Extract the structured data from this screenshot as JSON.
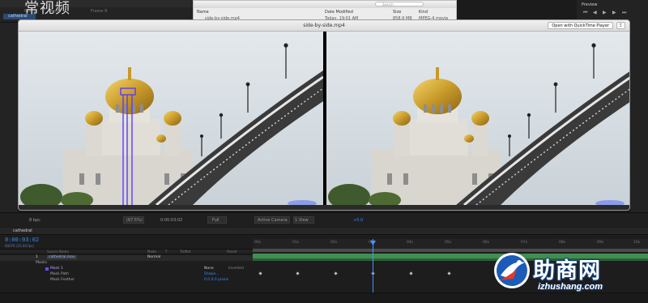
{
  "watermark_top": {
    "text": "常视频"
  },
  "project": {
    "columns": [
      "Name",
      "Type",
      "Frame R"
    ],
    "item": "cathedral"
  },
  "finder": {
    "columns": {
      "name": "Name",
      "date_modified": "Date Modified",
      "size": "Size",
      "kind": "Kind"
    },
    "row": {
      "name": "side-by-side.mp4",
      "date": "Today, 19:01 AM",
      "size": "858.9 MB",
      "kind": "MPEG-4 movie"
    },
    "search_placeholder": "Search"
  },
  "preview_panel": {
    "label": "Preview"
  },
  "quicktime": {
    "title": "side-by-side.mp4",
    "open_button": "Open with QuickTime Player",
    "share_icon": "share-icon"
  },
  "viewer_toolbar": {
    "bits": "8 bpc",
    "zoom": "(67.5%)",
    "timecode": "0:00:03:02",
    "resolution": "Full",
    "camera": "Active Camera",
    "views": "1 View",
    "exposure": "+0.0"
  },
  "timeline": {
    "comp_tab": "cathedral",
    "current_time": "0:00:03:02",
    "current_time_sub": "00076 (25.00 fps)",
    "columns": {
      "source_name": "Source Name",
      "mode": "Mode",
      "t": "T",
      "trkmat": "TrkMat",
      "parent": "Parent"
    },
    "layers": [
      {
        "num": "1",
        "name": "cathedral.mov",
        "mode": "Normal"
      },
      {
        "name": "Masks"
      },
      {
        "name": "Mask 1",
        "mode": "None",
        "extra": "Inverted"
      },
      {
        "name": "Mask Path",
        "value": "Shape..."
      },
      {
        "name": "Mask Feather",
        "value": "0.0,0.0 pixels"
      }
    ],
    "ruler": [
      "00s",
      "01s",
      "02s",
      "03s",
      "04s",
      "05s",
      "06s",
      "07s",
      "08s",
      "09s",
      "10s"
    ]
  },
  "watermark": {
    "brand_cn": "助商网",
    "url": "izhushang.com",
    "accent": "#1c5bb8",
    "accent2": "#e33a2a"
  }
}
